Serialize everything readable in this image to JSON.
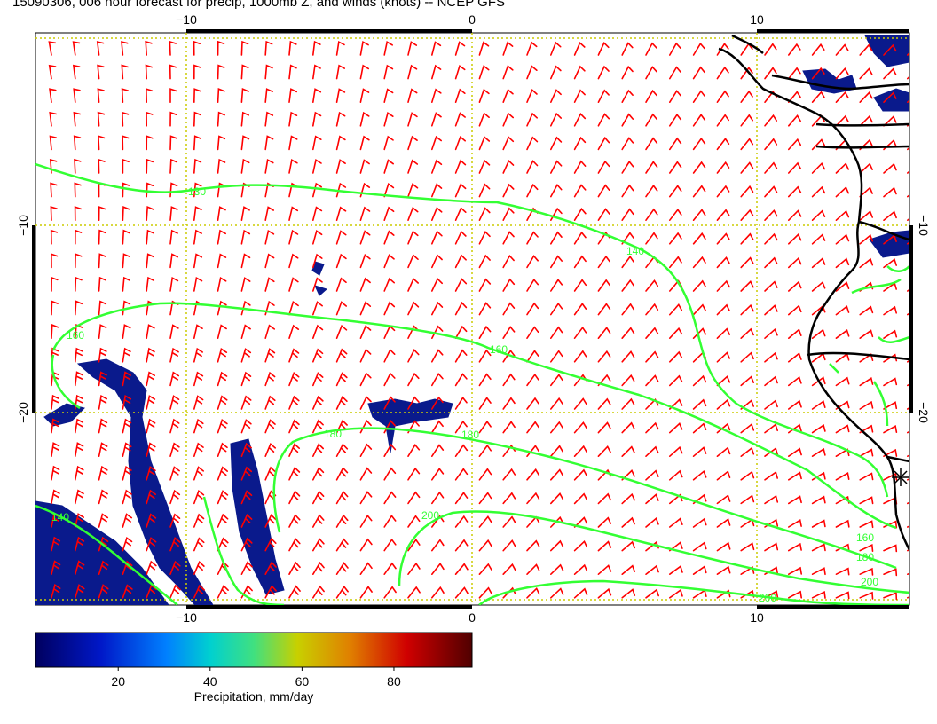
{
  "title": "15090306, 006 hour forecast for precip, 1000mb Z, and winds (knots) -- NCEP GFS",
  "map": {
    "lon_ticks": [
      "−10",
      "0",
      "10"
    ],
    "lat_ticks": [
      "−10",
      "−20"
    ],
    "lon_range": [
      -15.5,
      15
    ],
    "lat_range": [
      -30,
      0
    ]
  },
  "contours": [
    {
      "label": "130",
      "color": "#33ff33"
    },
    {
      "label": "140",
      "color": "#33ff33"
    },
    {
      "label": "160",
      "color": "#33ff33"
    },
    {
      "label": "180",
      "color": "#33ff33"
    },
    {
      "label": "200",
      "color": "#33ff33"
    }
  ],
  "colorbar": {
    "title": "Precipitation, mm/day",
    "ticks": [
      "20",
      "40",
      "60",
      "80"
    ],
    "range": [
      2,
      97
    ],
    "tick_values": [
      20,
      40,
      60,
      80
    ]
  },
  "colors": {
    "precip_low": "#0a1a8c",
    "contour": "#33ff33",
    "wind": "#ff0000",
    "grid": "#cccc00",
    "coast": "#000000"
  }
}
